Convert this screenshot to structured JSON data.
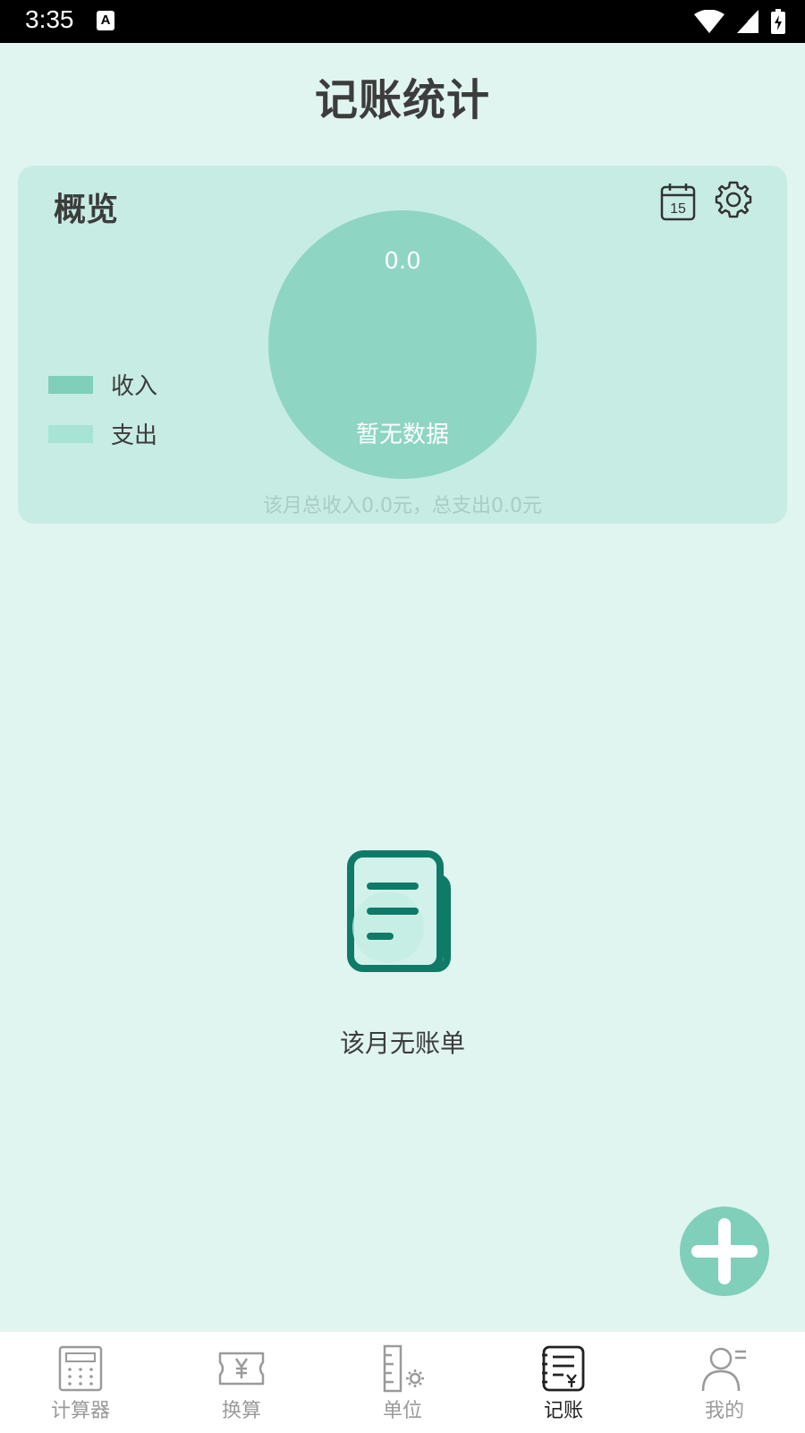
{
  "status_bar": {
    "time": "3:35",
    "notification_icon_letter": "A"
  },
  "page": {
    "title": "记账统计"
  },
  "overview": {
    "title": "概览",
    "calendar_day": "15",
    "legend": [
      {
        "label": "收入",
        "color": "#7fcfba"
      },
      {
        "label": "支出",
        "color": "#a8e4d6"
      }
    ],
    "chart_value": "0.0",
    "chart_empty_text": "暂无数据",
    "summary": "该月总收入0.0元，总支出0.0元"
  },
  "empty_state": {
    "text": "该月无账单"
  },
  "nav": {
    "items": [
      {
        "label": "计算器",
        "icon": "calculator-icon"
      },
      {
        "label": "换算",
        "icon": "currency-icon"
      },
      {
        "label": "单位",
        "icon": "ruler-gear-icon"
      },
      {
        "label": "记账",
        "icon": "ledger-icon",
        "active": true
      },
      {
        "label": "我的",
        "icon": "profile-icon"
      }
    ]
  },
  "colors": {
    "background": "#e0f4f0",
    "card": "#c7ece4",
    "chart": "#8ed5c4",
    "accent": "#7fcfba",
    "icon_dark": "#0f7a68"
  }
}
